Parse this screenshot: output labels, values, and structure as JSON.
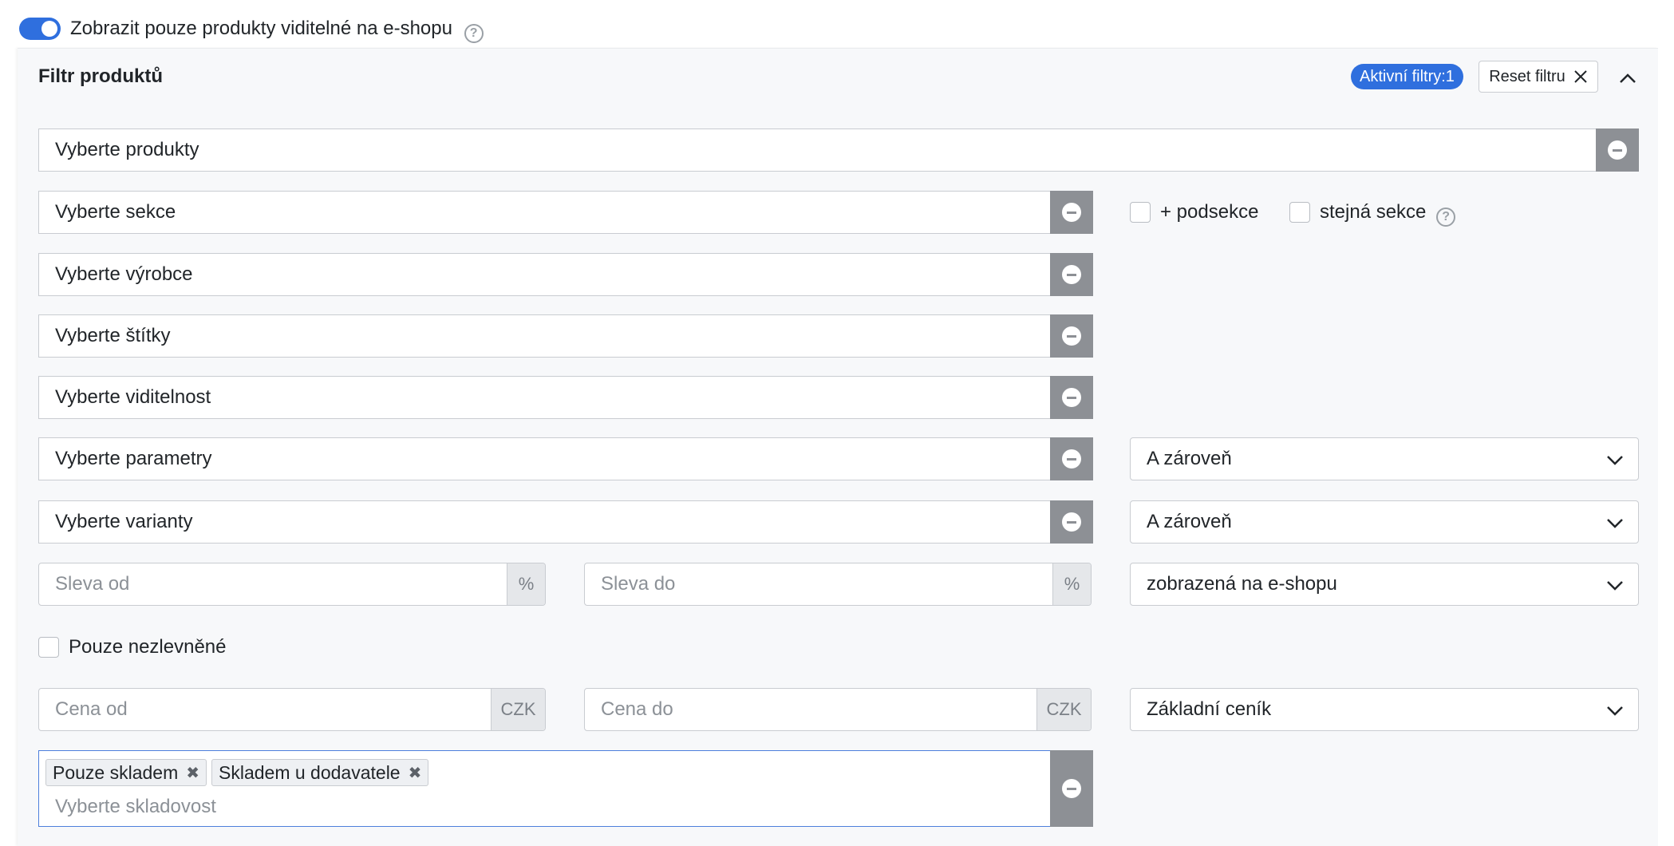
{
  "top_toggle": {
    "label": "Zobrazit pouze produkty viditelné na e-shopu",
    "on": true
  },
  "panel": {
    "title": "Filtr produktů",
    "active_filters": "Aktivní filtry:1",
    "reset_label": "Reset filtru"
  },
  "fields": {
    "products": "Vyberte produkty",
    "sections": "Vyberte sekce",
    "manufacturers": "Vyberte výrobce",
    "labels": "Vyberte štítky",
    "visibility": "Vyberte viditelnost",
    "parameters": "Vyberte parametry",
    "variants": "Vyberte varianty"
  },
  "section_options": {
    "subsections": "+ podsekce",
    "same_section": "stejná sekce"
  },
  "parameters_logic": "A zároveň",
  "variants_logic": "A zároveň",
  "discount": {
    "from_placeholder": "Sleva od",
    "to_placeholder": "Sleva do",
    "unit": "%",
    "display": "zobrazená na e-shopu"
  },
  "only_undiscounted": "Pouze nezlevněné",
  "price": {
    "from_placeholder": "Cena od",
    "to_placeholder": "Cena do",
    "currency": "CZK",
    "pricelist": "Základní ceník"
  },
  "stock": {
    "tags": [
      "Pouze skladem",
      "Skladem u dodavatele"
    ],
    "placeholder": "Vyberte skladovost"
  },
  "colors": {
    "accent": "#2f6fde",
    "clear_button": "#8d9095"
  }
}
